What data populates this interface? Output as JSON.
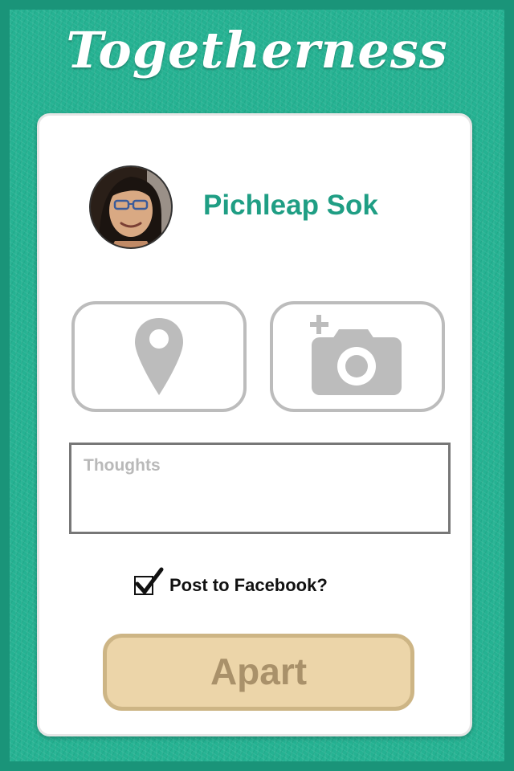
{
  "app": {
    "title": "Togetherness"
  },
  "user": {
    "name": "Pichleap Sok",
    "avatar_icon": "profile-photo"
  },
  "actions": {
    "location_icon": "map-pin-icon",
    "photo_icon": "add-camera-icon"
  },
  "thoughts": {
    "placeholder": "Thoughts",
    "value": ""
  },
  "facebook": {
    "label": "Post to Facebook?",
    "checked": true
  },
  "submit": {
    "label": "Apart"
  },
  "colors": {
    "brand_teal": "#1f9e84",
    "icon_gray": "#bcbcbc",
    "submit_bg": "#ecd5a9",
    "submit_text": "#a9916a"
  }
}
